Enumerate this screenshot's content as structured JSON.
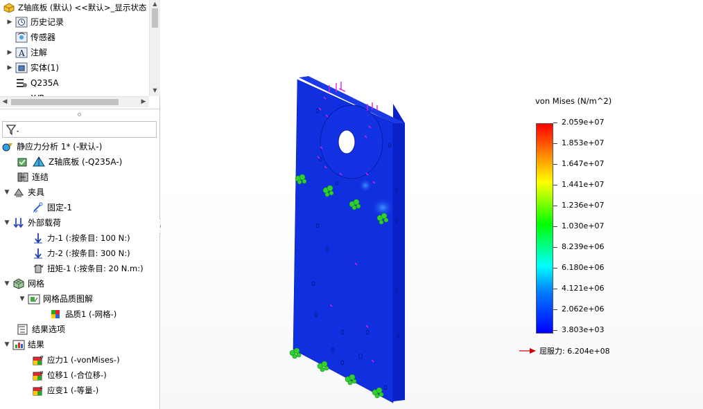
{
  "tree_top": {
    "root_label": "Z轴底板 (默认) <<默认>_显示状态",
    "items": [
      {
        "label": "历史记录",
        "icon": "history-icon"
      },
      {
        "label": "传感器",
        "icon": "sensor-icon"
      },
      {
        "label": "注解",
        "icon": "annotation-icon"
      },
      {
        "label": "实体(1)",
        "icon": "solid-body-icon"
      },
      {
        "label": "Q235A",
        "icon": "material-icon"
      }
    ],
    "partial_item": "X/R"
  },
  "study_tree": {
    "study": "静应力分析 1* (-默认-)",
    "part": "Z轴底板 (-Q235A-)",
    "connections": "连结",
    "fixtures": "夹具",
    "fixed": "固定-1",
    "external_loads": "外部载荷",
    "force1": "力-1 (:按条目: 100 N:)",
    "force2": "力-2 (:按条目: 300 N:)",
    "torque1": "扭矩-1 (:按条目: 20 N.m:)",
    "mesh": "网格",
    "mesh_quality_plot": "网格品质图解",
    "quality1": "品质1 (-网格-)",
    "result_options": "结果选项",
    "results": "结果",
    "stress1": "应力1 (-vonMises-)",
    "displacement1": "位移1 (-合位移-)",
    "strain1": "应变1 (-等量-)"
  },
  "legend": {
    "title": "von Mises (N/m^2)",
    "values": [
      "2.059e+07",
      "1.853e+07",
      "1.647e+07",
      "1.441e+07",
      "1.236e+07",
      "1.030e+07",
      "8.239e+06",
      "6.180e+06",
      "4.121e+06",
      "2.062e+06",
      "3.803e+03"
    ],
    "yield_label": "屈服力: 6.204e+08"
  },
  "colors": {
    "plate_blue": "#1030e0",
    "plate_side": "#0a22c8",
    "load_magenta": "#e020e0",
    "fixture_green": "#30d030",
    "yield_arrow": "#d00000"
  }
}
